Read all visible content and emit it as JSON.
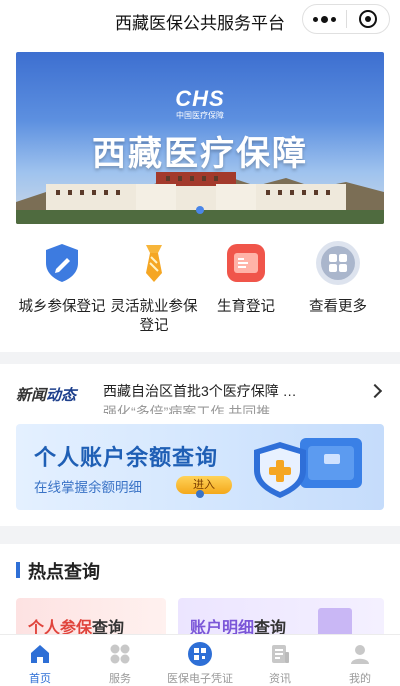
{
  "header": {
    "title": "西藏医保公共服务平台",
    "more_icon": "more-dots-icon",
    "close_icon": "miniprogram-close-icon"
  },
  "banner": {
    "logo_mark": "CHS",
    "logo_sub": "中国医疗保障",
    "headline": "西藏医疗保障"
  },
  "services": [
    {
      "label": "城乡参保登记",
      "icon": "shield-pen-icon",
      "color": "#3d7be0"
    },
    {
      "label": "灵活就业参保登记",
      "icon": "tie-icon",
      "color": "#f5a623"
    },
    {
      "label": "生育登记",
      "icon": "registration-card-icon",
      "color": "#f0554a"
    },
    {
      "label": "查看更多",
      "icon": "grid-more-icon",
      "color": "#7a8aa8"
    }
  ],
  "news": {
    "tag_a": "新闻",
    "tag_b": "动态",
    "line1": "西藏自治区首批3个医疗保障 …",
    "line2": "强化“多倍”病案工作 共同推"
  },
  "balance_card": {
    "title": "个人账户余额查询",
    "subtitle": "在线掌握余额明细",
    "enter": "进入"
  },
  "hot_query": {
    "title": "热点查询",
    "cards": [
      {
        "highlight": "个人参保",
        "rest": "查询"
      },
      {
        "highlight": "账户明细",
        "rest": "查询"
      }
    ]
  },
  "tabbar": [
    {
      "label": "首页",
      "icon": "home-icon",
      "active": true
    },
    {
      "label": "服务",
      "icon": "services-icon",
      "active": false
    },
    {
      "label": "医保电子凭证",
      "icon": "qr-code-icon",
      "active": false
    },
    {
      "label": "资讯",
      "icon": "news-icon",
      "active": false
    },
    {
      "label": "我的",
      "icon": "user-icon",
      "active": false
    }
  ]
}
